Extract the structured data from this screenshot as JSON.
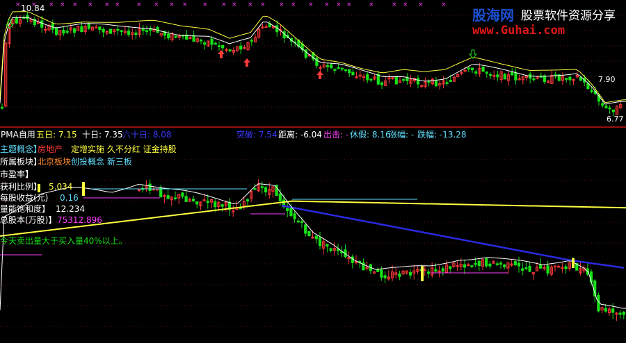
{
  "colors": {
    "up": "#ff3a3a",
    "down": "#18e018",
    "ma5": "#ffffff",
    "ma10": "#ffff40",
    "ma60_blue": "#2a2ae0",
    "ma_yellow_lower": "#ffff40",
    "divider": "#c81414",
    "cyan": "#5fdfff",
    "magenta": "#ff40ff",
    "yellow_text": "#ffff40"
  },
  "top_panel": {
    "high_label": "10.84",
    "price_right_1": "7.90",
    "price_right_2": "6.77"
  },
  "info_bar": {
    "indicator_name": "PMA自用",
    "ma5_label": "五日: 7.15",
    "ma10_label": "十日: 7.35",
    "ma60_label": "六十日: 8.08",
    "breakthrough_label": "突破: 7.54",
    "distance_label": "距离: -6.04",
    "exit_label": "出击: -",
    "rest_label": "休假: 8.16",
    "rise_label": "涨幅: -",
    "fall_label": "跌幅: -13.28"
  },
  "stock_info": {
    "concept_label": "主题概念】",
    "concept_sector": "房地产",
    "concept_tags": "定增实施 久不分红 证金持股",
    "sector_label": "所属板块】",
    "sector_value": "北京板块",
    "sector_tags": "创投概念 新三板",
    "pe_label": "市盈率】",
    "profit_label": "获利比例】",
    "profit_value": "5.034",
    "eps_label": "每股收益(元)",
    "eps_value": "0.16",
    "fund_label": "量能饱和度】",
    "fund_value": "12.234",
    "shares_label": "总股本(万股)】",
    "shares_value": "75312.896",
    "alert_text": "今天卖出量大于买入量40%以上。"
  },
  "watermark": {
    "brand": "股海网",
    "slogan": "股票软件资源分享",
    "url": "www.Guhai.com"
  }
}
